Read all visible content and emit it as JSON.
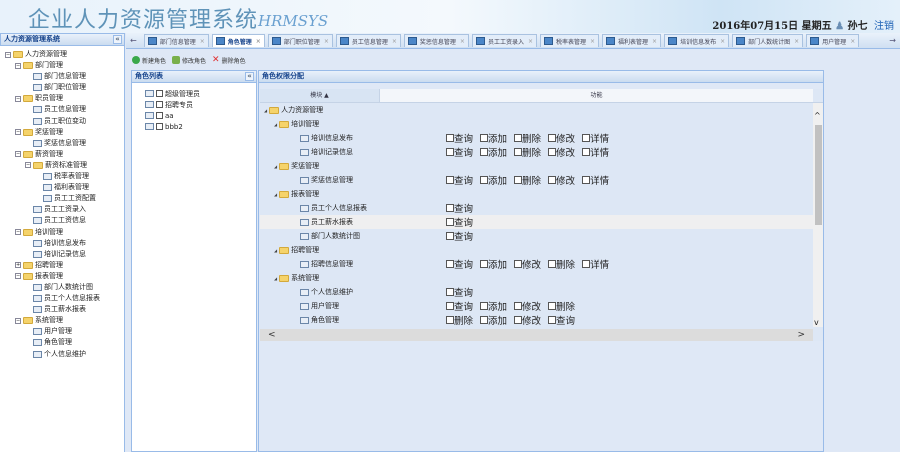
{
  "header": {
    "title": "企业人力资源管理系统",
    "logo": "HRMSYS",
    "date": "2016年07月15日 星期五",
    "user": "孙七",
    "logout": "注销"
  },
  "left": {
    "title": "人力资源管理系统",
    "collapse": "«",
    "tree": [
      {
        "label": "人力资源管理",
        "level": 0,
        "folder": true
      },
      {
        "label": "部门管理",
        "level": 1,
        "folder": true
      },
      {
        "label": "部门信息管理",
        "level": 2
      },
      {
        "label": "部门职位管理",
        "level": 2
      },
      {
        "label": "职员管理",
        "level": 1,
        "folder": true
      },
      {
        "label": "员工信息管理",
        "level": 2
      },
      {
        "label": "员工职位变动",
        "level": 2
      },
      {
        "label": "奖惩管理",
        "level": 1,
        "folder": true
      },
      {
        "label": "奖惩信息管理",
        "level": 2
      },
      {
        "label": "薪资管理",
        "level": 1,
        "folder": true
      },
      {
        "label": "薪资标准管理",
        "level": 2,
        "folder": true
      },
      {
        "label": "税率表管理",
        "level": 3
      },
      {
        "label": "福利表管理",
        "level": 3
      },
      {
        "label": "员工工资配置",
        "level": 3
      },
      {
        "label": "员工工资录入",
        "level": 2
      },
      {
        "label": "员工工资信息",
        "level": 2
      },
      {
        "label": "培训管理",
        "level": 1,
        "folder": true
      },
      {
        "label": "培训信息发布",
        "level": 2
      },
      {
        "label": "培训记录信息",
        "level": 2
      },
      {
        "label": "招聘管理",
        "level": 1,
        "folder": true,
        "collapsed": true
      },
      {
        "label": "报表管理",
        "level": 1,
        "folder": true
      },
      {
        "label": "部门人数统计图",
        "level": 2
      },
      {
        "label": "员工个人信息报表",
        "level": 2
      },
      {
        "label": "员工薪水报表",
        "level": 2
      },
      {
        "label": "系统管理",
        "level": 1,
        "folder": true
      },
      {
        "label": "用户管理",
        "level": 2
      },
      {
        "label": "角色管理",
        "level": 2
      },
      {
        "label": "个人信息维护",
        "level": 2
      }
    ]
  },
  "tabs": {
    "prev": "←",
    "next": "→",
    "items": [
      {
        "label": "部门信息管理"
      },
      {
        "label": "角色管理",
        "active": true
      },
      {
        "label": "部门职位管理"
      },
      {
        "label": "员工信息管理"
      },
      {
        "label": "奖惩信息管理"
      },
      {
        "label": "员工工资录入"
      },
      {
        "label": "税率表管理"
      },
      {
        "label": "福利表管理"
      },
      {
        "label": "培训信息发布"
      },
      {
        "label": "部门人数统计图"
      },
      {
        "label": "用户管理"
      }
    ]
  },
  "toolbar": {
    "add": "新建角色",
    "edit": "修改角色",
    "delete": "删除角色"
  },
  "roles": {
    "title": "角色列表",
    "collapse": "«",
    "items": [
      "超级管理员",
      "招聘专员",
      "aa",
      "bbb2"
    ]
  },
  "perm": {
    "title": "角色权限分配",
    "col_module": "模块 ▲",
    "col_func": "功能",
    "rows": [
      {
        "label": "人力资源管理",
        "level": 0,
        "folder": true,
        "feats": []
      },
      {
        "label": "培训管理",
        "level": 1,
        "folder": true,
        "feats": []
      },
      {
        "label": "培训信息发布",
        "level": 2,
        "feats": [
          "查询",
          "添加",
          "删除",
          "修改",
          "详情"
        ]
      },
      {
        "label": "培训记录信息",
        "level": 2,
        "feats": [
          "查询",
          "添加",
          "删除",
          "修改",
          "详情"
        ]
      },
      {
        "label": "奖惩管理",
        "level": 1,
        "folder": true,
        "feats": []
      },
      {
        "label": "奖惩信息管理",
        "level": 2,
        "feats": [
          "查询",
          "添加",
          "删除",
          "修改",
          "详情"
        ]
      },
      {
        "label": "报表管理",
        "level": 1,
        "folder": true,
        "feats": []
      },
      {
        "label": "员工个人信息报表",
        "level": 2,
        "feats": [
          "查询"
        ]
      },
      {
        "label": "员工薪水报表",
        "level": 2,
        "feats": [
          "查询"
        ],
        "highlight": true
      },
      {
        "label": "部门人数统计图",
        "level": 2,
        "feats": [
          "查询"
        ]
      },
      {
        "label": "招聘管理",
        "level": 1,
        "folder": true,
        "feats": []
      },
      {
        "label": "招聘信息管理",
        "level": 2,
        "feats": [
          "查询",
          "添加",
          "修改",
          "删除",
          "详情"
        ]
      },
      {
        "label": "系统管理",
        "level": 1,
        "folder": true,
        "feats": []
      },
      {
        "label": "个人信息维护",
        "level": 2,
        "feats": [
          "查询"
        ]
      },
      {
        "label": "用户管理",
        "level": 2,
        "feats": [
          "查询",
          "添加",
          "修改",
          "删除"
        ]
      },
      {
        "label": "角色管理",
        "level": 2,
        "feats": [
          "删除",
          "添加",
          "修改",
          "查询"
        ]
      }
    ]
  }
}
